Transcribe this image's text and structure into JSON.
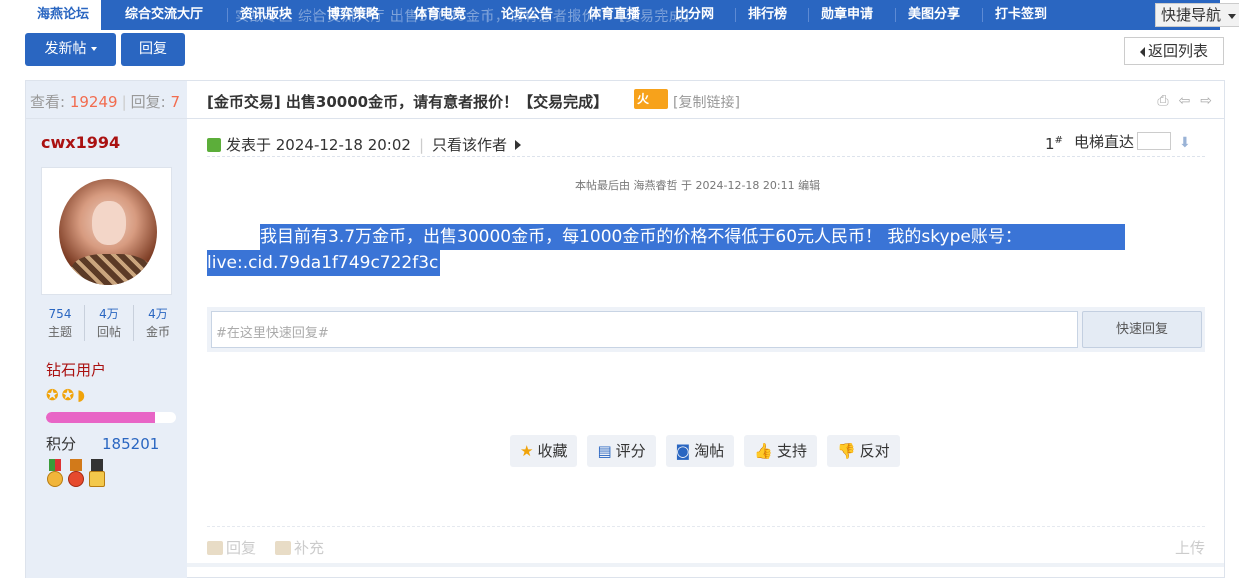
{
  "nav": {
    "background_text": "实战专区 综合交流大厅 出售30000金币，请有意者报价！【交易完成】",
    "items": [
      "海燕论坛",
      "综合交流大厅",
      "资讯版块",
      "博弈策略",
      "体育电竞",
      "论坛公告",
      "体育直播",
      "比分网",
      "排行榜",
      "勋章申请",
      "美图分享",
      "打卡签到"
    ],
    "quick_nav": "快捷导航"
  },
  "toolbar": {
    "new_post": "发新帖",
    "reply": "回复",
    "back_to_list": "返回列表"
  },
  "stats": {
    "views_label": "查看:",
    "views": "19249",
    "replies_label": "回复:",
    "replies": "7"
  },
  "thread": {
    "title": "[金币交易] 出售30000金币，请有意者报价！【交易完成】",
    "hot_badge": "火",
    "copy_link": "[复制链接]"
  },
  "author": {
    "name": "cwx1994",
    "stats": [
      {
        "value": "754",
        "label": "主题"
      },
      {
        "value": "4万",
        "label": "回帖"
      },
      {
        "value": "4万",
        "label": "金币"
      }
    ],
    "rank": "钻石用户",
    "stars": "✪✪◗",
    "progress": 0.84,
    "points_label": "积分",
    "points": "185201"
  },
  "post": {
    "posted_at": "发表于 2024-12-18 20:02",
    "only_author": "只看该作者",
    "floor": "1",
    "floor_suffix": "#",
    "elevator": "电梯直达",
    "edit_note": "本帖最后由 海燕睿哲 于 2024-12-18 20:11 编辑",
    "content_line1": "我目前有3.7万金币，出售30000金币，每1000金币的价格不得低于60元人民币！           我的skype账号：",
    "content_line2": "live:.cid.79da1f749c722f3c"
  },
  "quick_reply": {
    "placeholder": "#在这里快速回复#",
    "button": "快速回复"
  },
  "actions": [
    "收藏",
    "评分",
    "淘帖",
    "支持",
    "反对"
  ],
  "bottom": {
    "reply": "回复",
    "supplement": "补充",
    "upload": "上传"
  },
  "colors": {
    "nav_bg": "#2a66c1",
    "highlight": "#3a74d6",
    "accent_red": "#a11111",
    "progress_pink": "#e865c6"
  }
}
